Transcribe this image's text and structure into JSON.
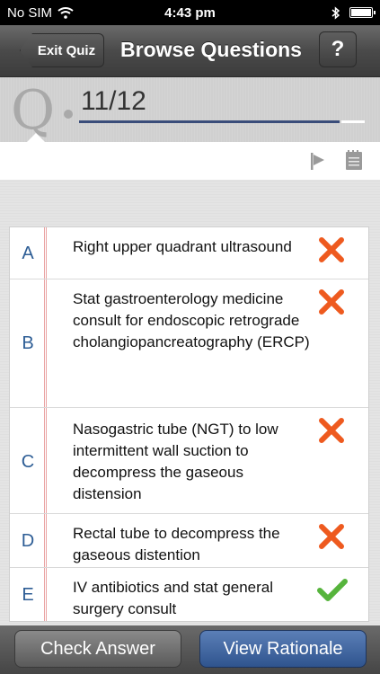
{
  "status_bar": {
    "carrier": "No SIM",
    "time": "4:43 pm"
  },
  "nav": {
    "back_label": "Exit Quiz",
    "title": "Browse Questions",
    "help_label": "?"
  },
  "question": {
    "letter": "Q",
    "counter": "11/12"
  },
  "answers": [
    {
      "letter": "A",
      "text": "Right upper quadrant ultrasound",
      "result": "incorrect"
    },
    {
      "letter": "B",
      "text": "Stat gastroenterology medicine consult for endoscopic retrograde cholangiopancreatography (ERCP)",
      "result": "incorrect"
    },
    {
      "letter": "C",
      "text": "Nasogastric tube (NGT) to low intermittent wall suction to decompress the gaseous distension",
      "result": "incorrect"
    },
    {
      "letter": "D",
      "text": "Rectal tube to decompress the gaseous distention",
      "result": "incorrect"
    },
    {
      "letter": "E",
      "text": "IV antibiotics and stat general surgery consult",
      "result": "correct"
    }
  ],
  "bottom": {
    "check_label": "Check Answer",
    "rationale_label": "View Rationale"
  },
  "colors": {
    "incorrect": "#ee5a1f",
    "correct": "#56b43c",
    "letter": "#2d5d95",
    "accent": "#2f548e"
  }
}
